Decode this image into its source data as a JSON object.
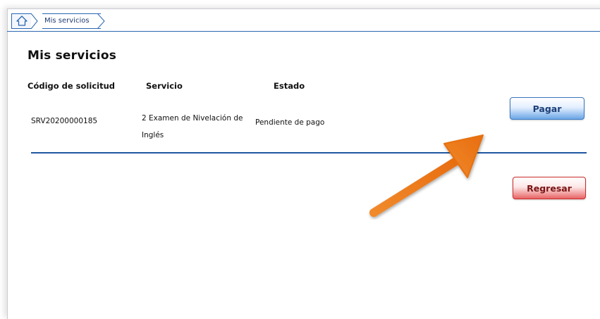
{
  "breadcrumb": {
    "home_icon": "home-icon",
    "current": "Mis servicios"
  },
  "page": {
    "title": "Mis servicios"
  },
  "table": {
    "headers": [
      "Código de solicitud",
      "Servicio",
      "Estado"
    ],
    "rows": [
      {
        "code": "SRV20200000185",
        "service": "2  Examen de Nivelación de Inglés",
        "status": "Pendiente de pago"
      }
    ]
  },
  "actions": {
    "pay_label": "Pagar",
    "back_label": "Regresar"
  },
  "colors": {
    "accent_blue": "#2a66b0",
    "divider_blue": "#1f57a0",
    "back_red": "#cc2b2b",
    "annotation_arrow": "#ef7a1a"
  }
}
